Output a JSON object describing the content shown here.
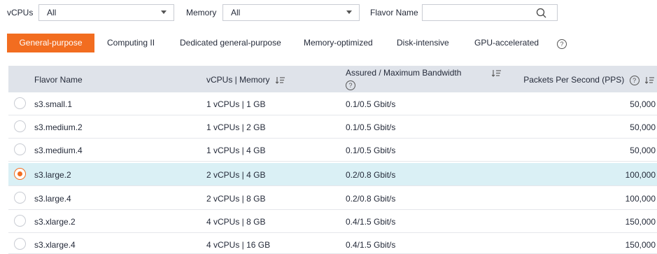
{
  "filters": {
    "vcpus_label": "vCPUs",
    "vcpus_value": "All",
    "memory_label": "Memory",
    "memory_value": "All",
    "flavor_name_label": "Flavor Name",
    "flavor_name_value": ""
  },
  "tabs": [
    {
      "label": "General-purpose",
      "active": true
    },
    {
      "label": "Computing II",
      "active": false
    },
    {
      "label": "Dedicated general-purpose",
      "active": false
    },
    {
      "label": "Memory-optimized",
      "active": false
    },
    {
      "label": "Disk-intensive",
      "active": false
    },
    {
      "label": "GPU-accelerated",
      "active": false
    }
  ],
  "help_glyph": "?",
  "table": {
    "headers": {
      "flavor_name": "Flavor Name",
      "vcpus_memory": "vCPUs | Memory",
      "bandwidth": "Assured / Maximum Bandwidth",
      "pps": "Packets Per Second (PPS)"
    },
    "rows": [
      {
        "name": "s3.small.1",
        "spec": "1 vCPUs | 1 GB",
        "bandwidth": "0.1/0.5 Gbit/s",
        "pps": "50,000",
        "selected": false
      },
      {
        "name": "s3.medium.2",
        "spec": "1 vCPUs | 2 GB",
        "bandwidth": "0.1/0.5 Gbit/s",
        "pps": "50,000",
        "selected": false
      },
      {
        "name": "s3.medium.4",
        "spec": "1 vCPUs | 4 GB",
        "bandwidth": "0.1/0.5 Gbit/s",
        "pps": "50,000",
        "selected": false
      },
      {
        "name": "s3.large.2",
        "spec": "2 vCPUs | 4 GB",
        "bandwidth": "0.2/0.8 Gbit/s",
        "pps": "100,000",
        "selected": true
      },
      {
        "name": "s3.large.4",
        "spec": "2 vCPUs | 8 GB",
        "bandwidth": "0.2/0.8 Gbit/s",
        "pps": "100,000",
        "selected": false
      },
      {
        "name": "s3.xlarge.2",
        "spec": "4 vCPUs | 8 GB",
        "bandwidth": "0.4/1.5 Gbit/s",
        "pps": "150,000",
        "selected": false
      },
      {
        "name": "s3.xlarge.4",
        "spec": "4 vCPUs | 16 GB",
        "bandwidth": "0.4/1.5 Gbit/s",
        "pps": "150,000",
        "selected": false
      }
    ]
  },
  "colors": {
    "accent": "#f26d20",
    "header_bg": "#dfe3ea",
    "selected_row_bg": "#daf0f5"
  },
  "icons": [
    "chevron-down-icon",
    "search-icon",
    "help-icon",
    "sort-icon",
    "radio-icon"
  ]
}
